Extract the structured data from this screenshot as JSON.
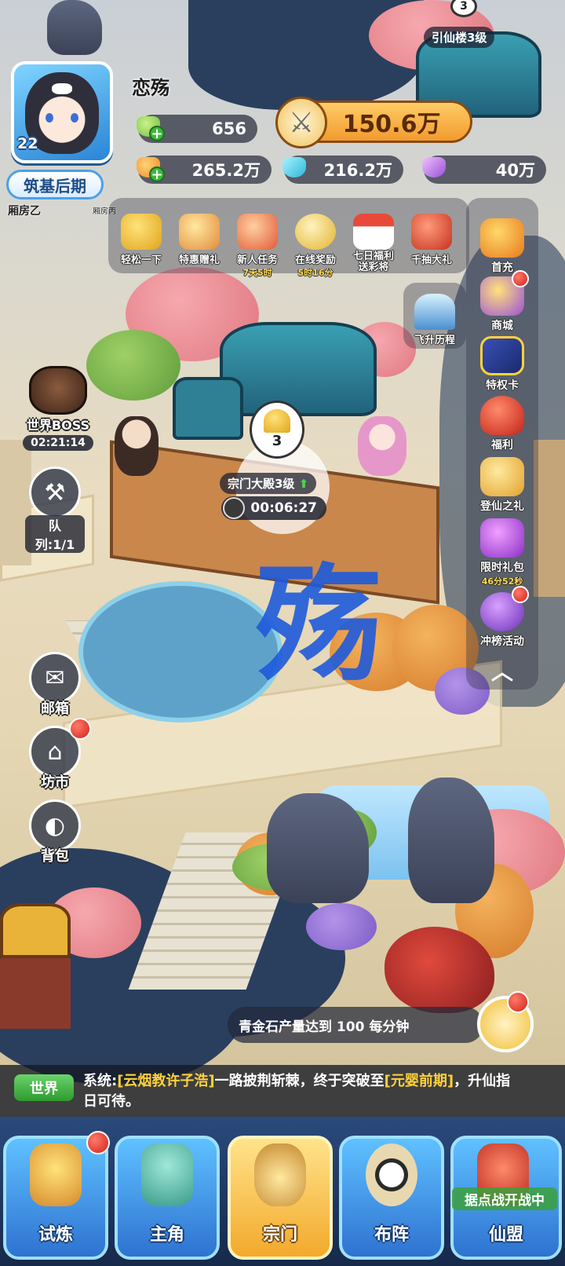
{
  "player": {
    "name": "恋殇",
    "level": "22",
    "rank": "筑基后期",
    "room_label": "厢房乙",
    "room_label_2": "厢房丙"
  },
  "building_top": {
    "label": "引仙楼3级",
    "badge": "3"
  },
  "resources": {
    "stamina": "656",
    "power": "150.6万",
    "spirit_fruit": "265.2万",
    "blue_gem": "216.2万",
    "purple_gem": "40万"
  },
  "gifts": [
    {
      "label": "轻松一下",
      "sub": "",
      "icon": "controller-icon"
    },
    {
      "label": "特惠赠礼",
      "sub": "",
      "icon": "gift-box-icon"
    },
    {
      "label": "新人任务",
      "sub": "7天5时",
      "icon": "scroll-quest-icon"
    },
    {
      "label": "在线奖励",
      "sub": "5时16分",
      "icon": "clock-icon"
    },
    {
      "label": "七日福利\n送彩将",
      "sub": "",
      "icon": "calendar-icon"
    },
    {
      "label": "千抽大礼",
      "sub": "",
      "icon": "chest-icon"
    }
  ],
  "ascension": {
    "label": "飞升历程",
    "icon": "crystal-mountain-icon"
  },
  "right_menu": [
    {
      "label": "首充",
      "sub": "",
      "icon": "first-charge-icon",
      "dot": false
    },
    {
      "label": "商城",
      "sub": "",
      "icon": "shop-icon",
      "dot": true
    },
    {
      "label": "特权卡",
      "sub": "",
      "icon": "privilege-card-icon",
      "dot": false
    },
    {
      "label": "福利",
      "sub": "",
      "icon": "welfare-bag-icon",
      "dot": false
    },
    {
      "label": "登仙之礼",
      "sub": "",
      "icon": "immortal-gift-icon",
      "dot": false
    },
    {
      "label": "限时礼包",
      "sub": "46分52秒",
      "icon": "limited-pack-icon",
      "dot": false
    },
    {
      "label": "冲榜活动",
      "sub": "",
      "icon": "ranking-event-icon",
      "dot": true
    }
  ],
  "world_boss": {
    "label": "世界BOSS",
    "timer": "02:21:14"
  },
  "queue": {
    "label": "队列:1/1"
  },
  "left_menu": [
    {
      "label": "邮箱",
      "icon": "mail-icon",
      "dot": false
    },
    {
      "label": "坊市",
      "icon": "market-icon",
      "dot": true
    },
    {
      "label": "背包",
      "icon": "bag-icon",
      "dot": false
    }
  ],
  "sect_hall": {
    "label": "宗门大殿3级",
    "level": "3",
    "timer": "00:06:27"
  },
  "calligraphy_char": "殇",
  "notice": {
    "text": "青金石产量达到 100 每分钟"
  },
  "chat": {
    "tag": "世界",
    "prefix": "系统:",
    "highlight1": "[云烟教许子浩]",
    "middle": "一路披荆斩棘，终于突破至",
    "highlight2": "[元婴前期]",
    "suffix": "，升仙指日可待。"
  },
  "bottom_nav": [
    {
      "label": "试炼",
      "icon": "trial-shrine-icon",
      "active": false,
      "dot": true,
      "banner": ""
    },
    {
      "label": "主角",
      "icon": "hero-statue-icon",
      "active": false,
      "dot": false,
      "banner": ""
    },
    {
      "label": "宗门",
      "icon": "sect-cauldron-icon",
      "active": true,
      "dot": false,
      "banner": ""
    },
    {
      "label": "布阵",
      "icon": "yin-yang-formation-icon",
      "active": false,
      "dot": false,
      "banner": ""
    },
    {
      "label": "仙盟",
      "icon": "alliance-banner-icon",
      "active": false,
      "dot": false,
      "banner": "据点战开战中"
    }
  ],
  "colors": {
    "accent_gold": "#f29b2e",
    "nav_blue": "#2e72d1",
    "badge_red": "#d2221a",
    "highlight_yellow": "#ffd23a"
  }
}
